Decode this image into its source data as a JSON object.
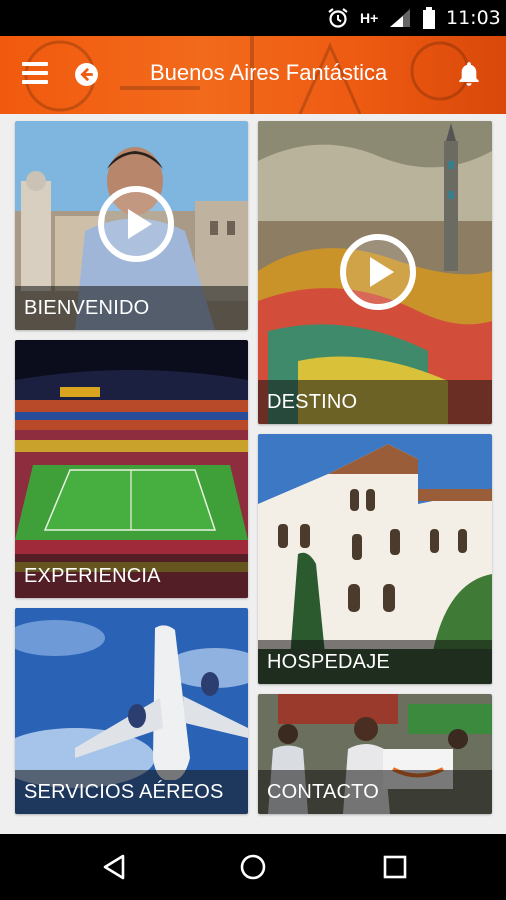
{
  "status_bar": {
    "network": "H+",
    "time": "11:03",
    "icons": [
      "alarm-icon",
      "signal-icon",
      "battery-icon"
    ]
  },
  "app_bar": {
    "title": "Buenos Aires Fantástica",
    "menu_icon": "hamburger-menu-icon",
    "back_icon": "back-arrow-circle-icon",
    "notification_icon": "bell-icon",
    "accent": "#f26a1c"
  },
  "tiles": [
    {
      "label": "BIENVENIDO",
      "has_video": true
    },
    {
      "label": "DESTINO",
      "has_video": true
    },
    {
      "label": "EXPERIENCIA",
      "has_video": false
    },
    {
      "label": "HOSPEDAJE",
      "has_video": false
    },
    {
      "label": "SERVICIOS AÉREOS",
      "has_video": false
    },
    {
      "label": "CONTACTO",
      "has_video": false
    }
  ],
  "nav_bar": {
    "icons": [
      "back-triangle-icon",
      "home-circle-icon",
      "recents-square-icon"
    ]
  }
}
